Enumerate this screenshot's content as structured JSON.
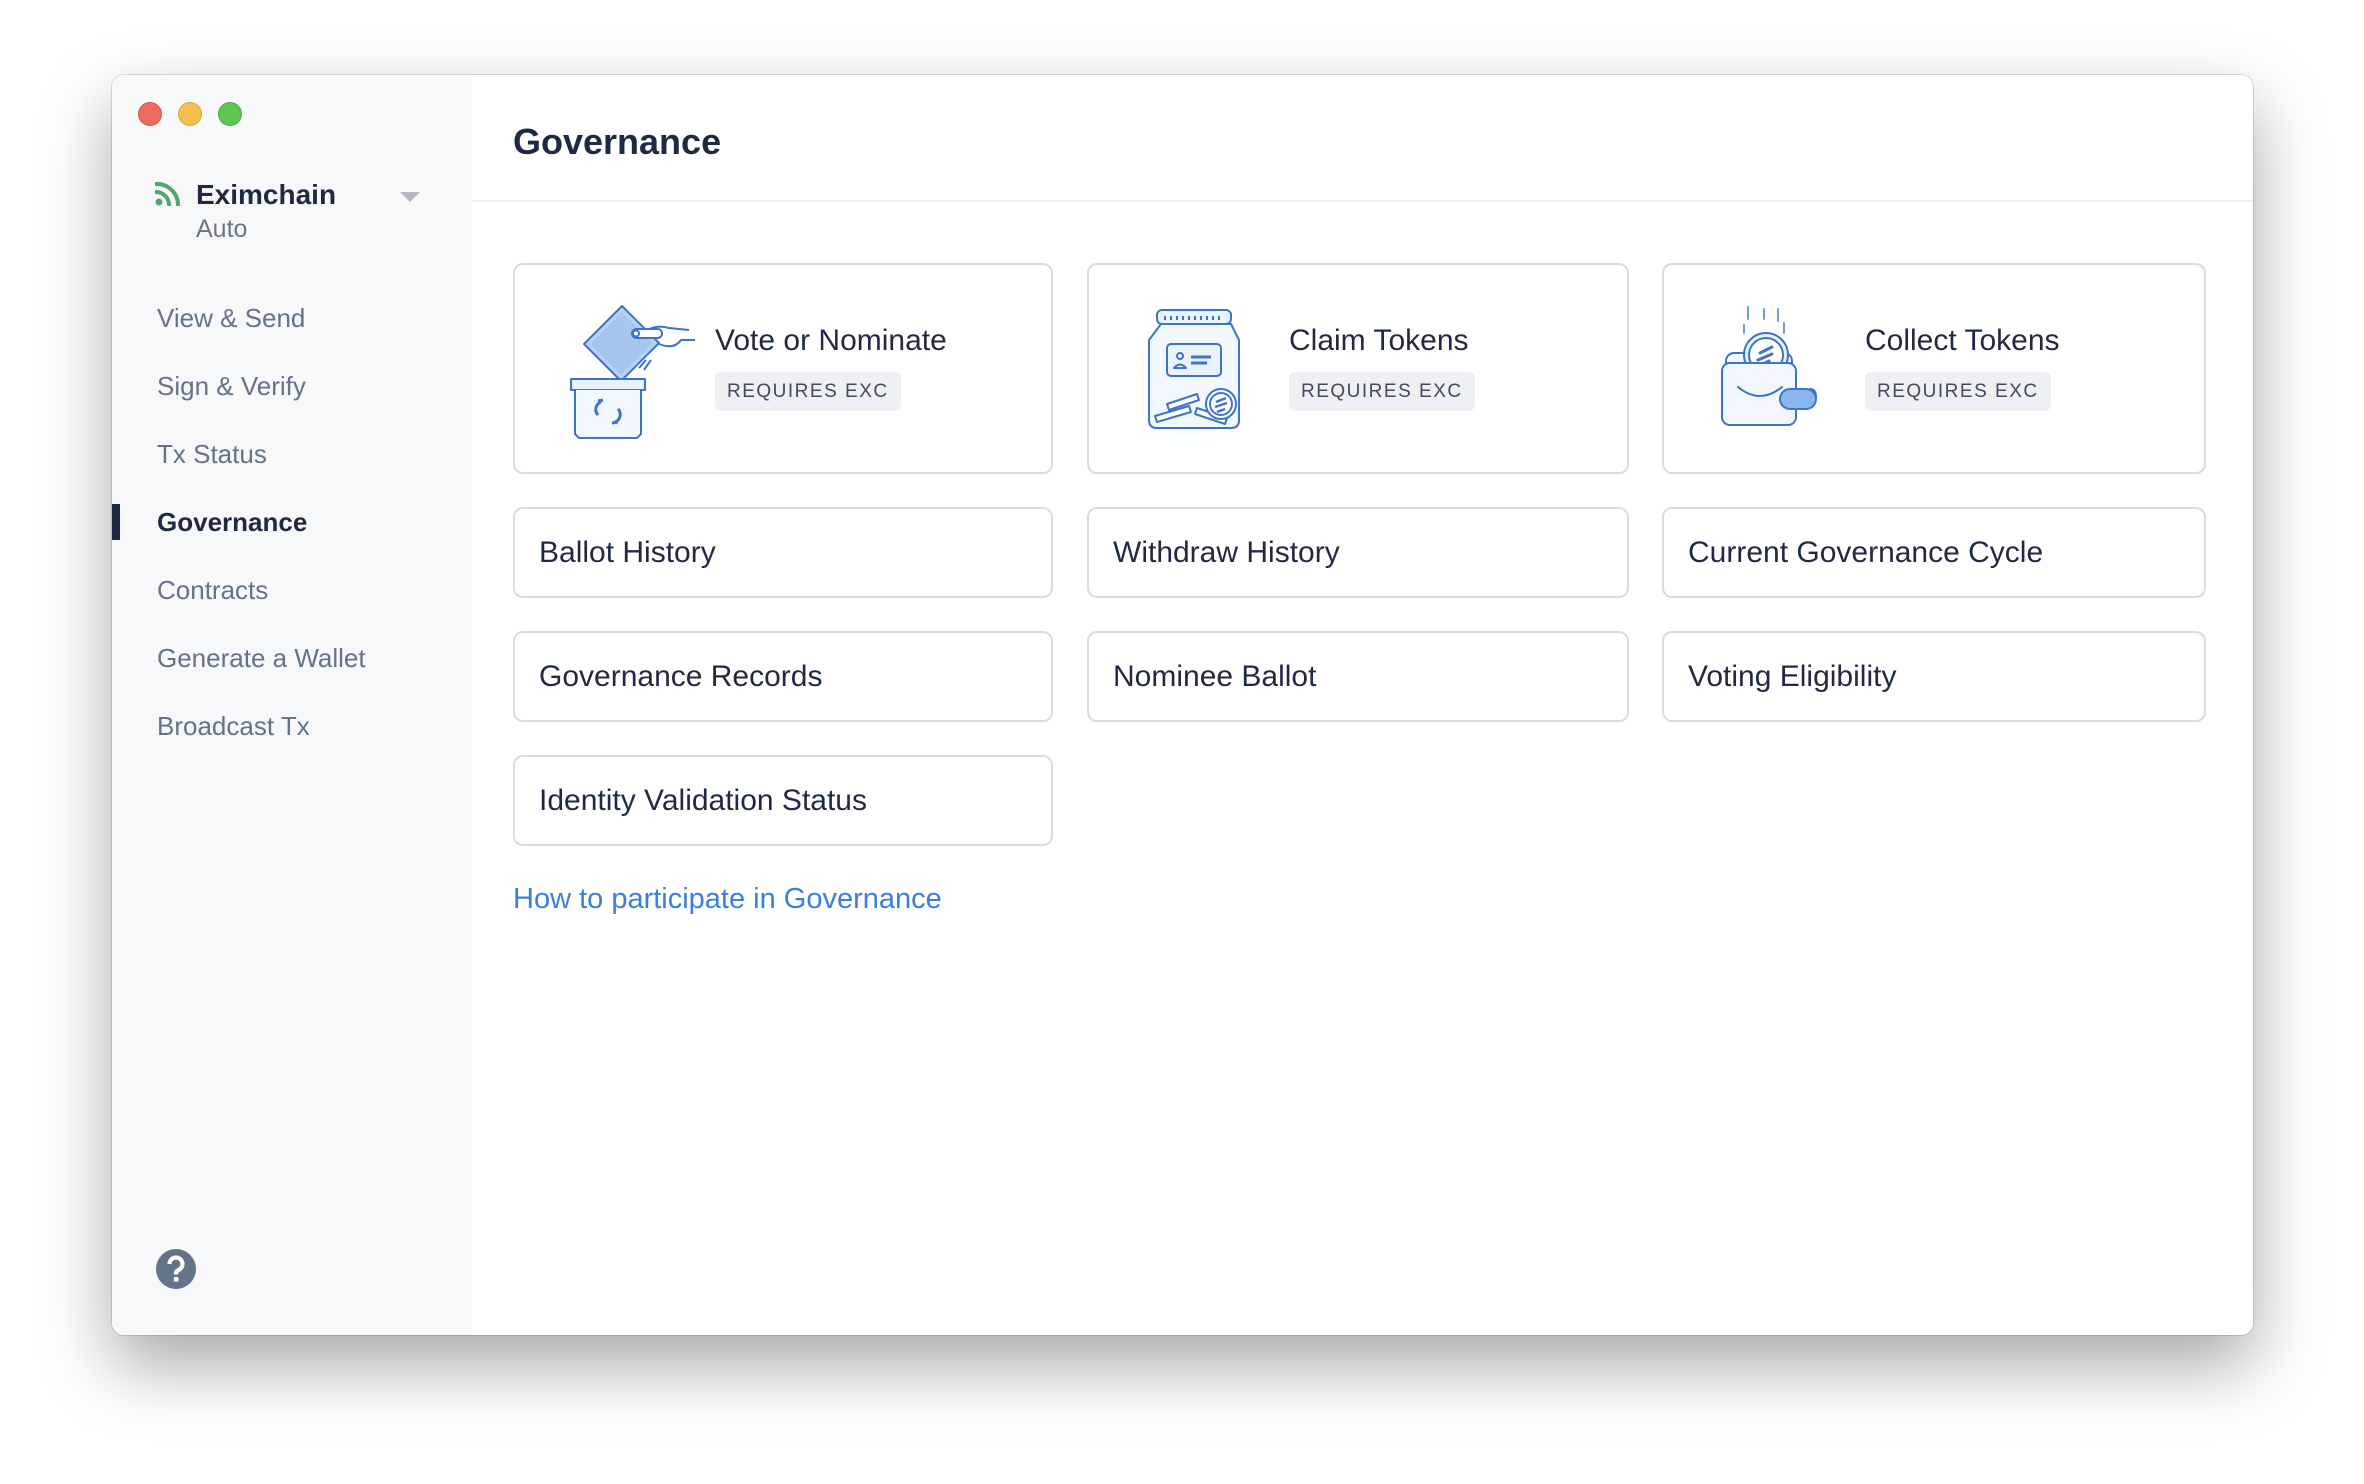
{
  "window": {
    "controls": [
      "close",
      "minimize",
      "maximize"
    ]
  },
  "sidebar": {
    "network": {
      "icon": "rss-signal-icon",
      "name": "Eximchain",
      "mode": "Auto",
      "status_color": "#4fa86a"
    },
    "items": [
      {
        "label": "View & Send",
        "active": false
      },
      {
        "label": "Sign & Verify",
        "active": false
      },
      {
        "label": "Tx Status",
        "active": false
      },
      {
        "label": "Governance",
        "active": true
      },
      {
        "label": "Contracts",
        "active": false
      },
      {
        "label": "Generate a Wallet",
        "active": false
      },
      {
        "label": "Broadcast Tx",
        "active": false
      }
    ],
    "help_icon": "question-circle-icon"
  },
  "main": {
    "title": "Governance",
    "feature_cards": [
      {
        "title": "Vote or Nominate",
        "badge": "REQUIRES EXC",
        "icon": "ballot-box-icon"
      },
      {
        "title": "Claim Tokens",
        "badge": "REQUIRES EXC",
        "icon": "token-jar-icon"
      },
      {
        "title": "Collect Tokens",
        "badge": "REQUIRES EXC",
        "icon": "wallet-coin-icon"
      }
    ],
    "links": [
      "Ballot History",
      "Withdraw History",
      "Current Governance Cycle",
      "Governance Records",
      "Nominee Ballot",
      "Voting Eligibility",
      "Identity Validation Status"
    ],
    "help_link": "How to participate in Governance"
  },
  "colors": {
    "accent": "#3b7fd9",
    "text_dark": "#1e2a44",
    "text_muted": "#637389",
    "sidebar_bg": "#f7f8fa",
    "card_border": "#d8dce2",
    "badge_bg": "#eef0f3"
  }
}
